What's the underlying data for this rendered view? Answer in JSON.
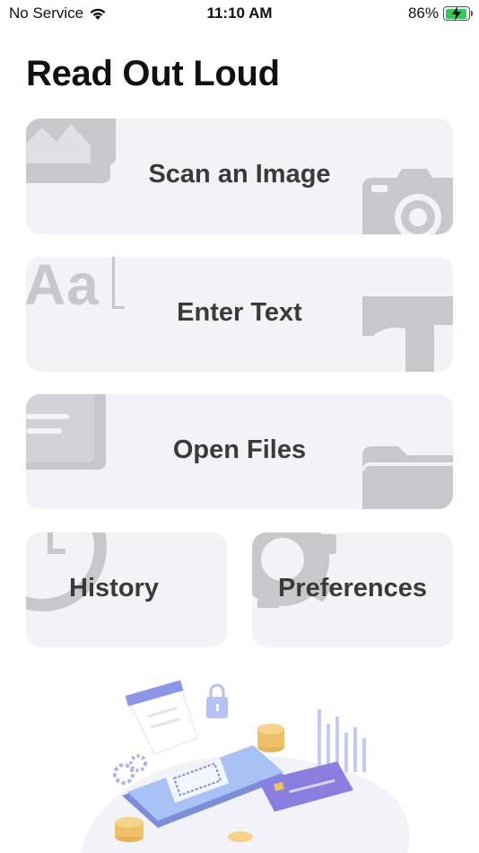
{
  "status_bar": {
    "carrier": "No Service",
    "time": "11:10 AM",
    "battery": "86%",
    "battery_level": 0.86
  },
  "page": {
    "title": "Read Out Loud"
  },
  "actions": {
    "scan_image": "Scan an Image",
    "enter_text": "Enter Text",
    "open_files": "Open Files",
    "history": "History",
    "preferences": "Preferences"
  },
  "decorations": {
    "aa_glyph": "Aa"
  },
  "colors": {
    "card_bg": "#f2f2f7",
    "card_icon": "#c7c7cc",
    "label": "#3a3a3c",
    "battery_green": "#34c759"
  }
}
